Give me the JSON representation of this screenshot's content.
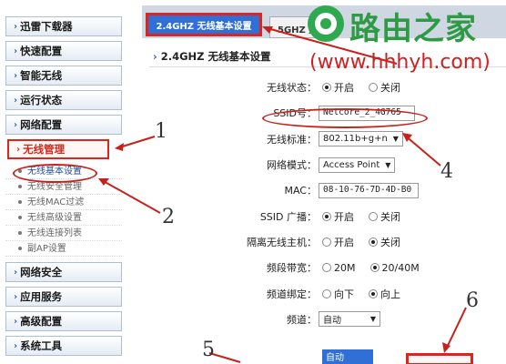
{
  "sidebar": {
    "menus_top": [
      {
        "label": "迅雷下载器"
      },
      {
        "label": "快速配置"
      },
      {
        "label": "智能无线"
      },
      {
        "label": "运行状态"
      },
      {
        "label": "网络配置"
      }
    ],
    "active_menu": "无线管理",
    "submenu": [
      {
        "label": "无线基本设置"
      },
      {
        "label": "无线安全管理"
      },
      {
        "label": "无线MAC过滤"
      },
      {
        "label": "无线高级设置"
      },
      {
        "label": "无线连接列表"
      },
      {
        "label": "副AP设置"
      }
    ],
    "menus_bottom": [
      {
        "label": "网络安全"
      },
      {
        "label": "应用服务"
      },
      {
        "label": "高级配置"
      },
      {
        "label": "系统工具"
      }
    ]
  },
  "tabs": {
    "tab1": "2.4GHZ 无线基本设置",
    "tab2": "5GHZ 无"
  },
  "section_title": "2.4GHZ 无线基本设置",
  "form": {
    "wireless_status": {
      "label": "无线状态：",
      "on": "开启",
      "off": "关闭",
      "selected": "开启"
    },
    "ssid": {
      "label": "SSID号：",
      "value": "Netcore_2_4G765"
    },
    "standard": {
      "label": "无线标准：",
      "value": "802.11b+g+n"
    },
    "network_mode": {
      "label": "网络模式：",
      "value": "Access Point"
    },
    "mac": {
      "label": "MAC：",
      "value": "08-10-76-7D-4D-B0"
    },
    "ssid_broadcast": {
      "label": "SSID 广播：",
      "on": "开启",
      "off": "关闭",
      "selected": "开启"
    },
    "isolate": {
      "label": "隔离无线主机：",
      "on": "开启",
      "off": "关闭",
      "selected": "关闭"
    },
    "bandwidth": {
      "label": "频段带宽：",
      "opt1": "20M",
      "opt2": "20/40M",
      "selected": "20/40M"
    },
    "channel_bind": {
      "label": "频道绑定：",
      "opt1": "向下",
      "opt2": "向上",
      "selected": "向上"
    },
    "channel": {
      "label": "频道：",
      "value": "自动",
      "dropdown_item": "自动"
    }
  },
  "annotations": [
    "1",
    "2",
    "4",
    "5",
    "6"
  ],
  "watermark": {
    "title": "路由之家",
    "url": "(www.hhhyh.com)"
  },
  "colors": {
    "accent_red": "#e0241b",
    "tab_blue": "#2f6fd6",
    "watermark_green": "#2f9a46",
    "watermark_red": "#cc2222"
  }
}
